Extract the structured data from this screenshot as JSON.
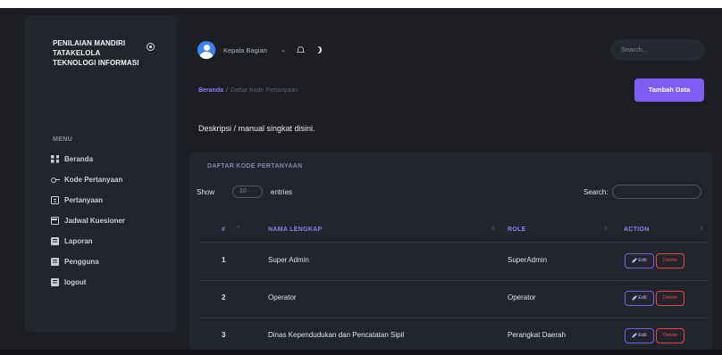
{
  "sidebar": {
    "brand": "PENILAIAN MANDIRI TATAKELOLA TEKNOLOGI INFORMASI",
    "menu_title": "MENU",
    "items": [
      {
        "label": "Beranda",
        "icon": "grid-icon"
      },
      {
        "label": "Kode Pertanyaan",
        "icon": "key-icon"
      },
      {
        "label": "Pertanyaan",
        "icon": "document-icon"
      },
      {
        "label": "Jadwal Kuesioner",
        "icon": "calendar-icon"
      },
      {
        "label": "Laporan",
        "icon": "book-icon"
      },
      {
        "label": "Pengguna",
        "icon": "book-icon"
      },
      {
        "label": "logout",
        "icon": "book-icon"
      }
    ]
  },
  "topbar": {
    "user": "Kepala Bagian",
    "search_placeholder": "Search..."
  },
  "breadcrumb": {
    "home": "Beranda",
    "separator": "/",
    "current": "Daftar Kode Pertanyaan"
  },
  "header": {
    "add_button": "Tambah Data",
    "description": "Deskripsi / manual singkat disini."
  },
  "card": {
    "title": "DAFTAR KODE PERTANYAAN",
    "show_label": "Show",
    "page_length": "10",
    "entries_label": "entries",
    "search_label": "Search:"
  },
  "table": {
    "columns": [
      "#",
      "NAMA LENGKAP",
      "ROLE",
      "ACTION"
    ],
    "edit_label": "Edit",
    "delete_label": "Delete",
    "rows": [
      {
        "no": "1",
        "name": "Super Admin",
        "role": "SuperAdmin"
      },
      {
        "no": "2",
        "name": "Operator",
        "role": "Operator"
      },
      {
        "no": "3",
        "name": "Dinas Kependudukan dan Pencatatan Sipil",
        "role": "Perangkat Daerah"
      }
    ]
  },
  "colors": {
    "accent": "#7c5cf2",
    "danger": "#ef4444",
    "background": "#1c1e24",
    "panel": "#23252c"
  }
}
